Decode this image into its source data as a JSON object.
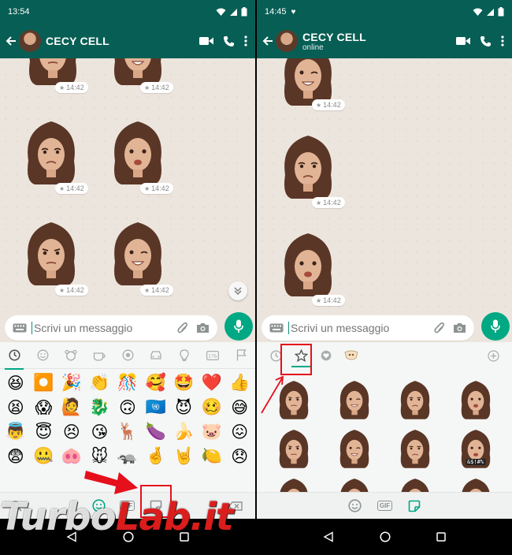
{
  "left_screen": {
    "status": {
      "time": "13:54",
      "extra": ""
    },
    "header": {
      "contact_name": "CECY CELL",
      "contact_status": ""
    },
    "messages": [
      "14:42",
      "14:42",
      "14:42",
      "14:42",
      "14:42",
      "14:42",
      "14:42"
    ],
    "composer": {
      "placeholder": "Scrivi un messaggio"
    },
    "panel_mode": "emoji",
    "emoji_category_icons": [
      "clock-icon",
      "smiley-icon",
      "animal-icon",
      "food-icon",
      "ball-icon",
      "car-icon",
      "bulb-icon",
      "symbols-icon",
      "flag-icon"
    ],
    "emoji_rows": [
      [
        "😆",
        "⏺️",
        "🎉",
        "👏",
        "🎊",
        "🥰",
        "🤩",
        "❤️",
        "👍"
      ],
      [
        "😫",
        "😱",
        "🙋",
        "🐉",
        "🙃",
        "🇺🇳",
        "😈",
        "🥴",
        "😅"
      ],
      [
        "👼",
        "😇",
        "😣",
        "😘",
        "🦌",
        "🍆",
        "🍌",
        "🐷",
        "😖"
      ],
      [
        "😨",
        "🤐",
        "🐽",
        "🐭",
        "🦡",
        "🤞",
        "🤘",
        "🍋",
        "😞"
      ]
    ],
    "bottom_tabs": {
      "gif_label": "GIF"
    }
  },
  "right_screen": {
    "status": {
      "time": "14:45",
      "extra": "♥"
    },
    "header": {
      "contact_name": "CECY CELL",
      "contact_status": "online"
    },
    "messages": [
      "14:42",
      "14:42",
      "14:42"
    ],
    "composer": {
      "placeholder": "Scrivi un messaggio"
    },
    "panel_mode": "stickers",
    "sticker_tab_icons": [
      "clock-icon",
      "star-icon",
      "heart-icon",
      "sticker-pack-icon",
      "plus-icon"
    ],
    "sticker_caption": "&$!#%",
    "bottom_tabs": {
      "gif_label": "GIF"
    }
  },
  "watermark": {
    "brand_first": "Turbo",
    "brand_second": "Lab.it"
  },
  "colors": {
    "header": "#075e54",
    "accent": "#00a884",
    "highlight": "#e5101b",
    "chat_bg": "#ece5dd"
  }
}
